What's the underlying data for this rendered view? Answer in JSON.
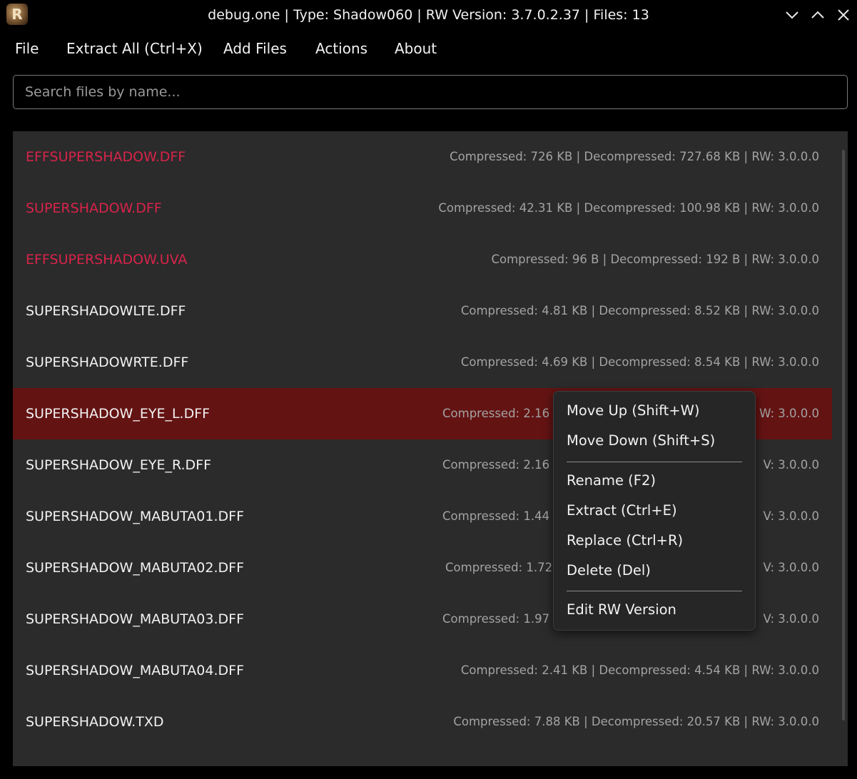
{
  "window": {
    "title": "debug.one | Type: Shadow060 | RW Version: 3.7.0.2.37 | Files: 13",
    "app_icon_letter": "R",
    "controls": [
      "chevron-down-icon",
      "chevron-up-icon",
      "close-icon"
    ]
  },
  "menu": {
    "items": [
      "File",
      "Extract All (Ctrl+X)",
      "Add Files",
      "Actions",
      "About"
    ]
  },
  "search": {
    "placeholder": "Search files by name..."
  },
  "files": [
    {
      "name": "EFFSUPERSHADOW.DFF",
      "meta": "Compressed: 726 KB | Decompressed: 727.68 KB | RW: 3.0.0.0",
      "highlight": true
    },
    {
      "name": "SUPERSHADOW.DFF",
      "meta": "Compressed: 42.31 KB | Decompressed: 100.98 KB | RW: 3.0.0.0",
      "highlight": true
    },
    {
      "name": "EFFSUPERSHADOW.UVA",
      "meta": "Compressed: 96 B | Decompressed: 192 B | RW: 3.0.0.0",
      "highlight": true
    },
    {
      "name": "SUPERSHADOWLTE.DFF",
      "meta": "Compressed: 4.81 KB | Decompressed: 8.52 KB | RW: 3.0.0.0",
      "highlight": false
    },
    {
      "name": "SUPERSHADOWRTE.DFF",
      "meta": "Compressed: 4.69 KB | Decompressed: 8.54 KB | RW: 3.0.0.0",
      "highlight": false
    },
    {
      "name": "SUPERSHADOW_EYE_L.DFF",
      "meta": "Compressed: 2.16",
      "meta_tail": "W: 3.0.0.0",
      "highlight": false,
      "selected": true
    },
    {
      "name": "SUPERSHADOW_EYE_R.DFF",
      "meta": "Compressed: 2.16",
      "meta_tail": "V: 3.0.0.0",
      "highlight": false
    },
    {
      "name": "SUPERSHADOW_MABUTA01.DFF",
      "meta": "Compressed: 1.44",
      "meta_tail": "V: 3.0.0.0",
      "highlight": false
    },
    {
      "name": "SUPERSHADOW_MABUTA02.DFF",
      "meta": "Compressed: 1.72",
      "meta_tail": "V: 3.0.0.0",
      "highlight": false
    },
    {
      "name": "SUPERSHADOW_MABUTA03.DFF",
      "meta": "Compressed: 1.97",
      "meta_tail": "V: 3.0.0.0",
      "highlight": false
    },
    {
      "name": "SUPERSHADOW_MABUTA04.DFF",
      "meta": "Compressed: 2.41 KB | Decompressed: 4.54 KB | RW: 3.0.0.0",
      "highlight": false
    },
    {
      "name": "SUPERSHADOW.TXD",
      "meta": "Compressed: 7.88 KB | Decompressed: 20.57 KB | RW: 3.0.0.0",
      "highlight": false
    }
  ],
  "context_menu": {
    "groups": [
      [
        "Move Up (Shift+W)",
        "Move Down (Shift+S)"
      ],
      [
        "Rename (F2)",
        "Extract (Ctrl+E)",
        "Replace (Ctrl+R)",
        "Delete (Del)"
      ],
      [
        "Edit RW Version"
      ]
    ]
  },
  "colors": {
    "highlight_name": "#d8234a",
    "selected_row": "#641313",
    "list_bg": "#2b2b2b"
  }
}
